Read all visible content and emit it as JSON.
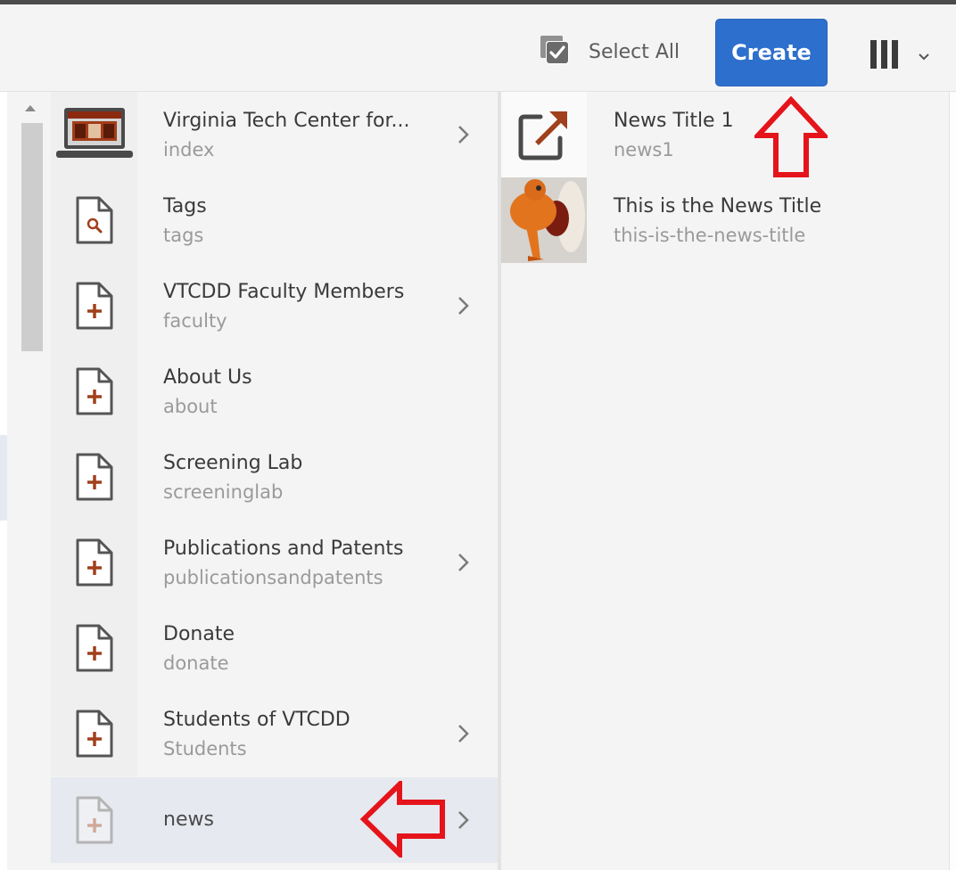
{
  "toolbar": {
    "select_all_label": "Select All",
    "create_label": "Create",
    "view_icon": "column-view-icon",
    "accent_color": "#2d6fcc"
  },
  "columns": [
    {
      "items": [
        {
          "title": "Virginia Tech Center for...",
          "name": "index",
          "icon": "site-laptop-icon",
          "has_children": true,
          "selected": false
        },
        {
          "title": "Tags",
          "name": "tags",
          "icon": "search-page-icon",
          "has_children": false,
          "selected": false
        },
        {
          "title": "VTCDD Faculty Members",
          "name": "faculty",
          "icon": "page-icon",
          "has_children": true,
          "selected": false
        },
        {
          "title": "About Us",
          "name": "about",
          "icon": "page-icon",
          "has_children": false,
          "selected": false
        },
        {
          "title": "Screening Lab",
          "name": "screeninglab",
          "icon": "page-icon",
          "has_children": false,
          "selected": false
        },
        {
          "title": "Publications and Patents",
          "name": "publicationsandpatents",
          "icon": "page-icon",
          "has_children": true,
          "selected": false
        },
        {
          "title": "Donate",
          "name": "donate",
          "icon": "page-icon",
          "has_children": false,
          "selected": false
        },
        {
          "title": "Students of VTCDD",
          "name": "Students",
          "icon": "page-icon",
          "has_children": true,
          "selected": false
        },
        {
          "title": "news",
          "name": "",
          "icon": "page-icon-faded",
          "has_children": true,
          "selected": true
        }
      ]
    },
    {
      "items": [
        {
          "title": "News Title 1",
          "name": "news1",
          "icon": "redirect-page-icon"
        },
        {
          "title": "This is the News Title",
          "name": "this-is-the-news-title",
          "icon": "mascot-thumbnail-image"
        }
      ]
    }
  ],
  "annotations": {
    "color": "#e5141b",
    "arrows": [
      "up-arrow-annotation",
      "left-arrow-annotation"
    ]
  }
}
